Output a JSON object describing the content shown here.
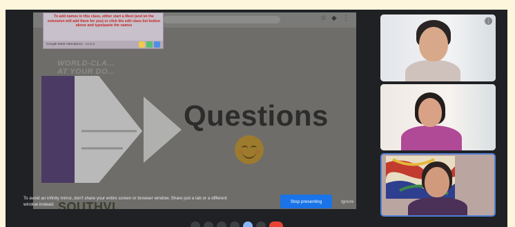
{
  "slide": {
    "tagline_line1": "WORLD-CLA...",
    "tagline_line2": "AT YOUR DO...",
    "title": "Questions",
    "bottom_text": "SOUTHVI"
  },
  "extension_popup": {
    "message": "To add names in this class, either start a Meet (and let the extension will add them for you) or click the edit class list button above and type/paste the names",
    "footer_label": "Google Meet Attendance - v1.0.2"
  },
  "share_warning": {
    "text": "To avoid an infinity mirror, don't share your entire screen or browser window. Share just a tab or a different window instead.",
    "stop_button": "Stop presenting",
    "ignore_button": "Ignore"
  },
  "colors": {
    "meet_background": "#202124",
    "stop_button": "#1a73e8",
    "warning_text": "#c42424",
    "active_speaker_border": "#4f7fd6"
  },
  "icons": [
    "more-options-icon",
    "mic-icon",
    "camera-icon",
    "captions-icon",
    "present-icon",
    "end-call-icon"
  ]
}
